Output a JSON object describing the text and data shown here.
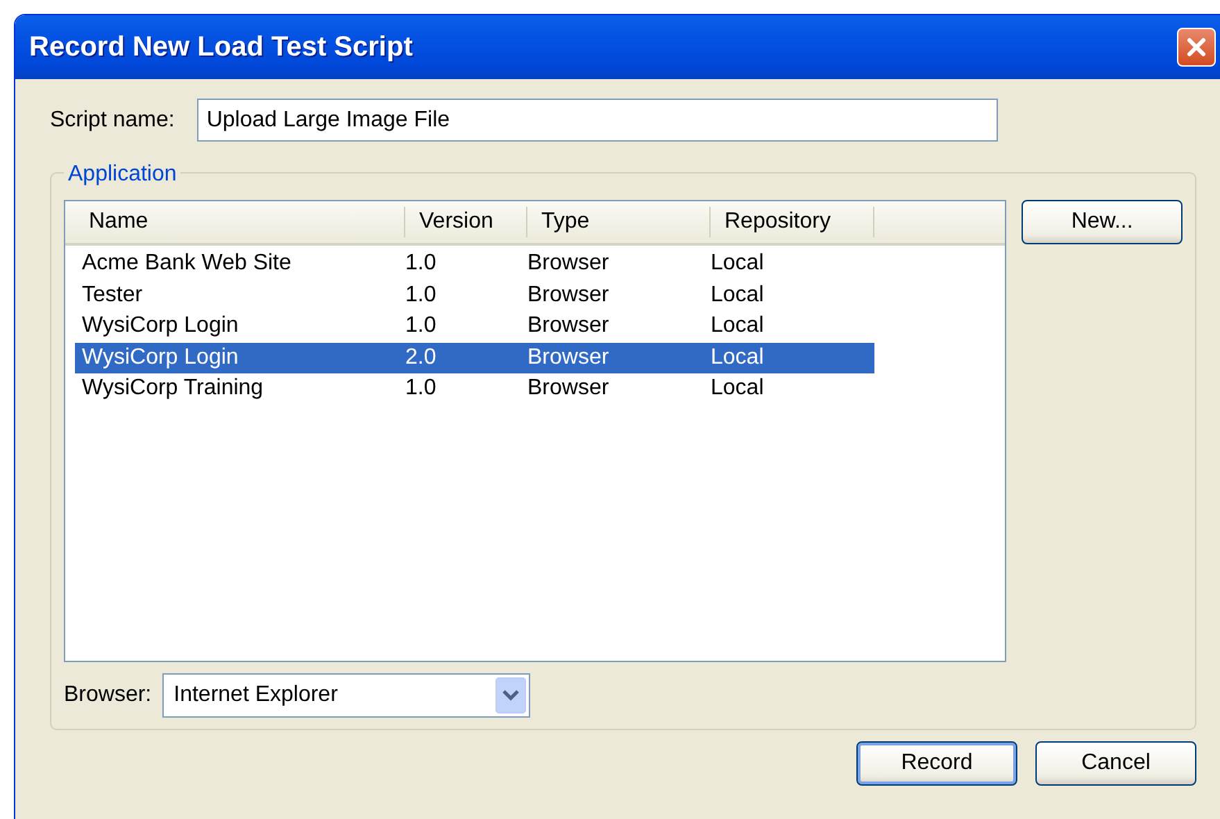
{
  "window": {
    "title": "Record New Load Test Script"
  },
  "script_name": {
    "label": "Script name:",
    "value": "Upload Large Image File"
  },
  "application": {
    "legend": "Application",
    "columns": [
      "Name",
      "Version",
      "Type",
      "Repository"
    ],
    "rows": [
      {
        "cells": [
          "Acme Bank Web Site",
          "1.0",
          "Browser",
          "Local"
        ],
        "selected": false
      },
      {
        "cells": [
          "Tester",
          "1.0",
          "Browser",
          "Local"
        ],
        "selected": false
      },
      {
        "cells": [
          "WysiCorp Login",
          "1.0",
          "Browser",
          "Local"
        ],
        "selected": false
      },
      {
        "cells": [
          "WysiCorp Login",
          "2.0",
          "Browser",
          "Local"
        ],
        "selected": true
      },
      {
        "cells": [
          "WysiCorp Training",
          "1.0",
          "Browser",
          "Local"
        ],
        "selected": false
      }
    ],
    "new_button": "New...",
    "browser": {
      "label": "Browser:",
      "value": "Internet Explorer"
    }
  },
  "buttons": [
    {
      "label": "Record",
      "default": true
    },
    {
      "label": "Cancel",
      "default": false
    }
  ]
}
